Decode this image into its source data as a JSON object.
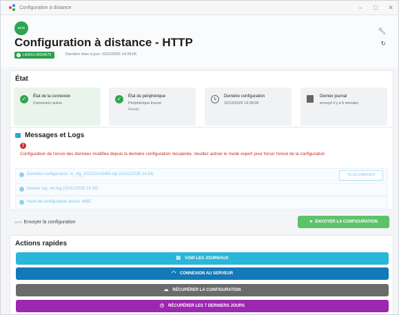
{
  "window": {
    "title": "Configuration à distance",
    "controls": [
      "–",
      "□",
      "✕"
    ]
  },
  "header": {
    "logo_text": "HTTP",
    "title": "Configuration à distance - HTTP",
    "device_id": "LA0012-00034675",
    "last_update": "Dernière mise à jour: 10/12/2025 14:39:06"
  },
  "etat": {
    "title": "État",
    "tiles": [
      {
        "title": "État de la connexion",
        "line1": "Connexion active",
        "line2": "",
        "icon": "check-icon"
      },
      {
        "title": "État du périphérique",
        "line1": "Périphérique trouvé",
        "line2": "Ready",
        "icon": "check-icon"
      },
      {
        "title": "Dernière configuration",
        "line1": "10/12/2025 14:39:06",
        "line2": "",
        "icon": "clock-icon"
      },
      {
        "title": "Dernier journal",
        "line1": "envoyé il y a 5 minutes",
        "line2": "",
        "icon": "journal-icon"
      }
    ]
  },
  "logs": {
    "title": "Messages et Logs",
    "warning": "Configuration de l'envoi des données modifiée depuis la dernière configuration récupérée. Veuillez activer le mode expert pour forcer l'envoi de la configuration",
    "rows": [
      "Dernière configuration: m_cfg_251210143454.zip (10/12/2025 14:39)",
      "Dernier log: net.log (10/12/2025 14:39)",
      "Hash de configuration actuel: 486E"
    ],
    "download_label": "TÉLÉCHARGER"
  },
  "send": {
    "tag": "HTTP",
    "label": "Envoyer la configuration",
    "button": "ENVOYER LA CONFIGURATION"
  },
  "quick_actions": {
    "title": "Actions rapides",
    "buttons": [
      {
        "label": "VOIR LES JOURNAUX",
        "color": "#29b6d8"
      },
      {
        "label": "CONNEXION AU SERVEUR",
        "color": "#1479b8"
      },
      {
        "label": "RÉCUPÉRER LA CONFIGURATION",
        "color": "#6b6b6b"
      },
      {
        "label": "RÉCUPÉRER LES 7 DERNIERS JOURS",
        "color": "#9c27b0"
      }
    ]
  }
}
